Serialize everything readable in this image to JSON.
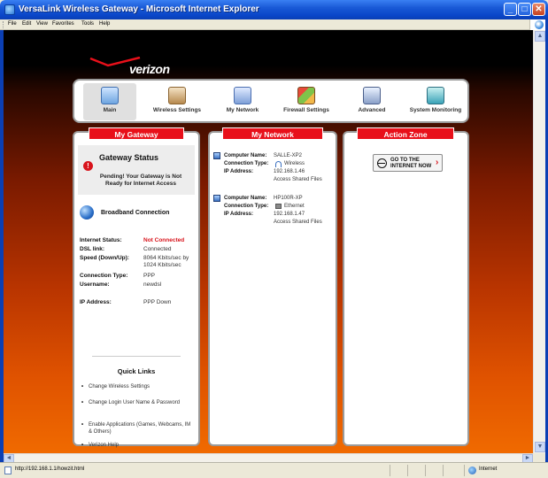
{
  "window": {
    "title": "VersaLink Wireless Gateway - Microsoft Internet Explorer",
    "min_glyph": "_",
    "max_glyph": "□",
    "close_glyph": "✕"
  },
  "menu": [
    "File",
    "Edit",
    "View",
    "Favorites",
    "Tools",
    "Help"
  ],
  "logo": {
    "text": "verizon"
  },
  "nav": [
    {
      "label": "Main",
      "icon": "main-icon"
    },
    {
      "label": "Wireless Settings",
      "icon": "wireless-settings-icon"
    },
    {
      "label": "My Network",
      "icon": "my-network-icon"
    },
    {
      "label": "Firewall Settings",
      "icon": "firewall-settings-icon"
    },
    {
      "label": "Advanced",
      "icon": "advanced-icon"
    },
    {
      "label": "System Monitoring",
      "icon": "system-monitoring-icon"
    }
  ],
  "gateway": {
    "header": "My Gateway",
    "warn_glyph": "!",
    "status_title": "Gateway Status",
    "status_msg": "Pending! Your Gateway is Not Ready for Internet Access",
    "broadband_title": "Broadband Connection",
    "rows": [
      {
        "k": "Internet Status:",
        "v": "Not Connected"
      },
      {
        "k": "DSL link:",
        "v": "Connected"
      },
      {
        "k": "Speed (Down/Up):",
        "v": "8064 Kbits/sec by",
        "v2": "1024 Kbits/sec"
      },
      {
        "k": "Connection Type:",
        "v": "PPP"
      },
      {
        "k": "Username:",
        "v": "newdsl"
      },
      {
        "k": "IP Address:",
        "v": "PPP Down"
      }
    ],
    "quick_links_title": "Quick Links",
    "quick_links": [
      "Change Wireless Settings",
      "Change Login User Name & Password",
      "Enable Applications (Games, Webcams, IM & Others)",
      "Verizon Help"
    ]
  },
  "network": {
    "header": "My Network",
    "labels": {
      "computer_name": "Computer Name:",
      "connection_type": "Connection Type:",
      "ip_address": "IP Address:"
    },
    "computers": [
      {
        "name": "SALLE-XP2",
        "type": "Wireless",
        "ip": "192.168.1.46",
        "action": "Access Shared Files"
      },
      {
        "name": "HP100R-XP",
        "type": "Ethernet",
        "ip": "192.168.1.47",
        "action": "Access Shared Files"
      }
    ]
  },
  "action_zone": {
    "header": "Action Zone",
    "button": "GO TO THE INTERNET NOW",
    "chevron": "›"
  },
  "scroll": {
    "up": "▲",
    "down": "▼",
    "left": "◄",
    "right": "►"
  },
  "status": {
    "url": "http://192.168.1.1/howzit.html",
    "zone": "Internet"
  }
}
